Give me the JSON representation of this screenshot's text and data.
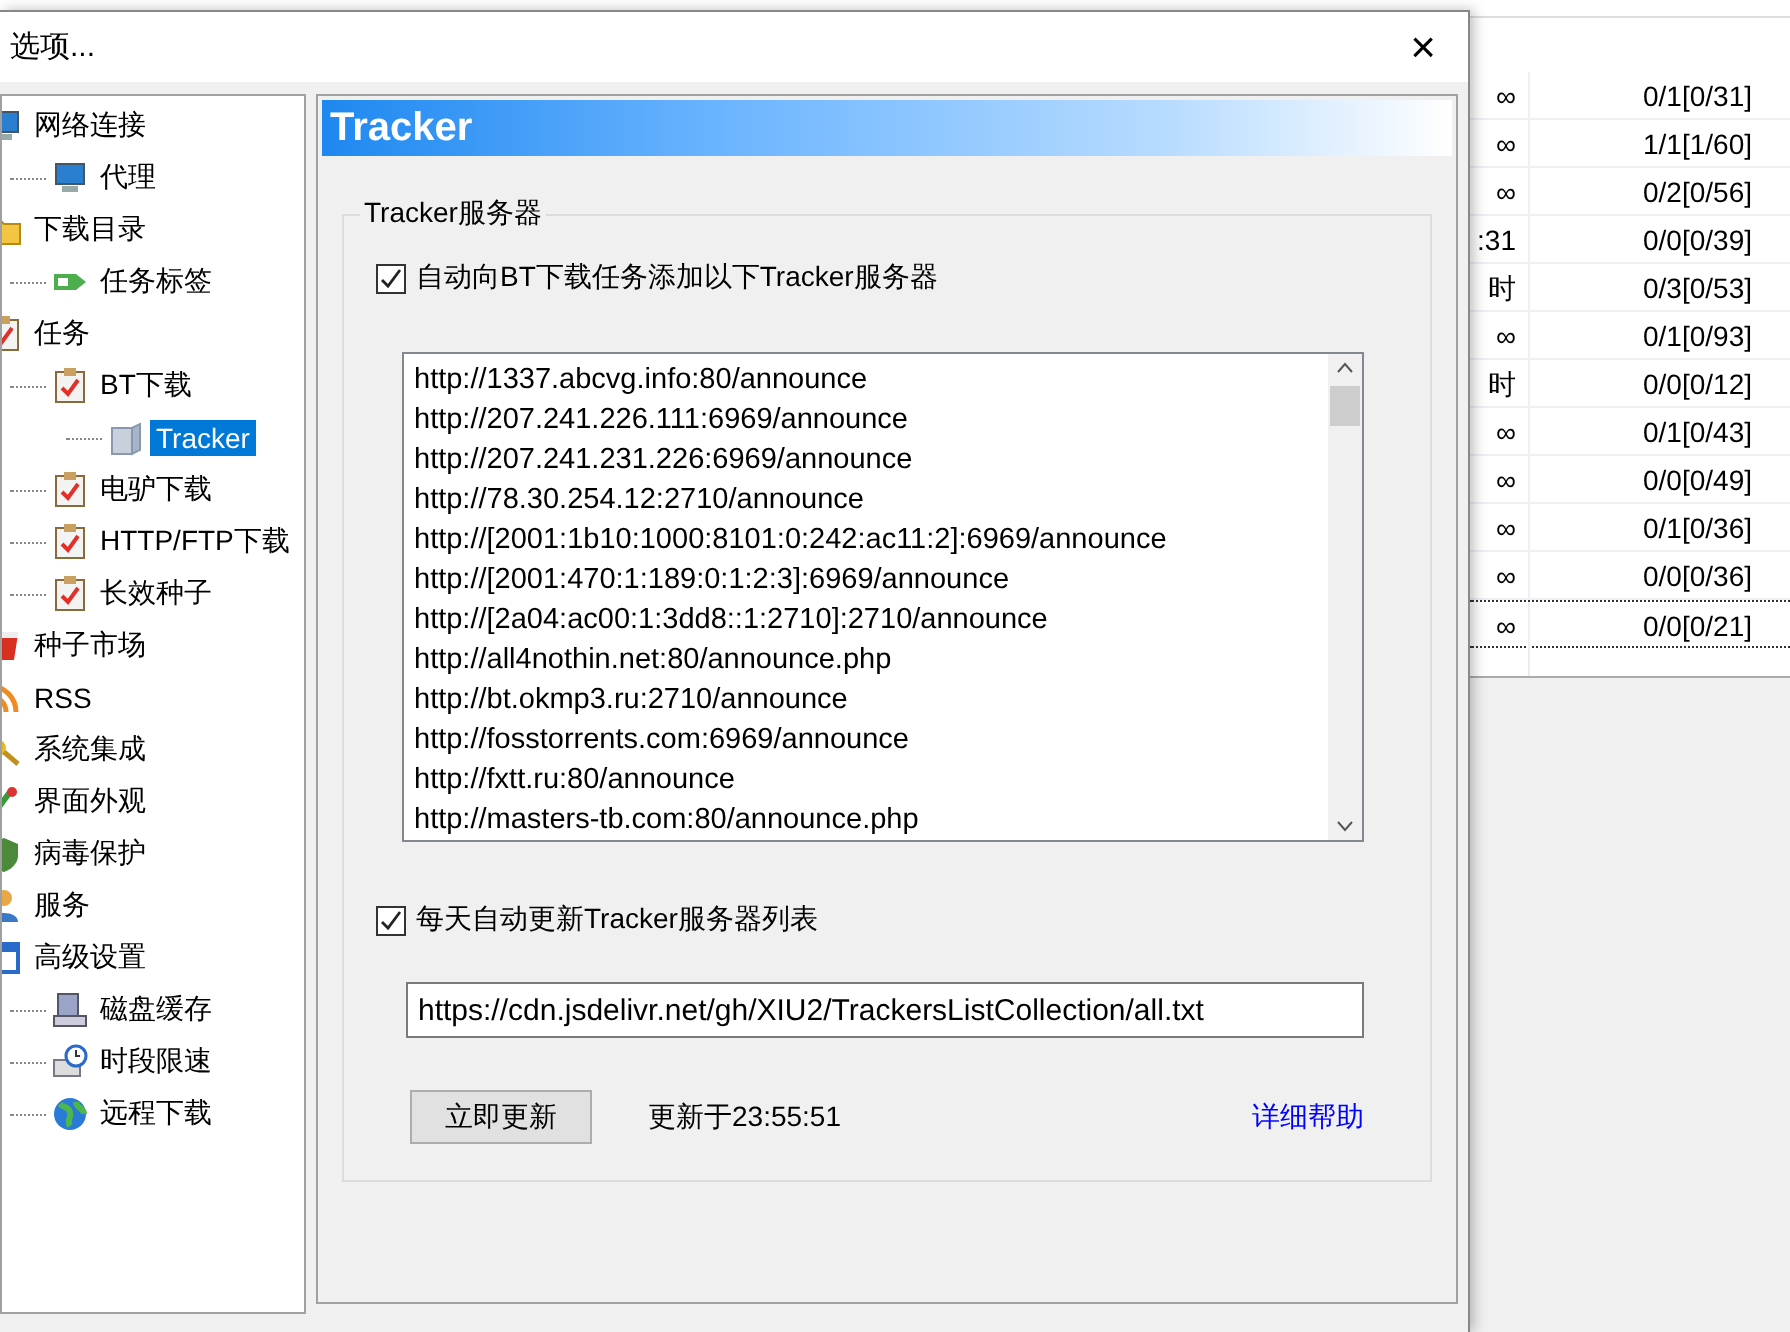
{
  "window": {
    "title": "选项...",
    "close": "×"
  },
  "tree": [
    {
      "label": "网络连接",
      "selected": false,
      "children": [
        {
          "label": "代理",
          "selected": false
        }
      ]
    },
    {
      "label": "下载目录",
      "selected": false,
      "children": [
        {
          "label": "任务标签",
          "selected": false
        }
      ]
    },
    {
      "label": "任务",
      "selected": false,
      "children": [
        {
          "label": "BT下载",
          "selected": false,
          "children": [
            {
              "label": "Tracker",
              "selected": true
            }
          ]
        },
        {
          "label": "电驴下载",
          "selected": false
        },
        {
          "label": "HTTP/FTP下载",
          "selected": false
        },
        {
          "label": "长效种子",
          "selected": false
        }
      ]
    },
    {
      "label": "种子市场",
      "selected": false
    },
    {
      "label": "RSS",
      "selected": false
    },
    {
      "label": "系统集成",
      "selected": false
    },
    {
      "label": "界面外观",
      "selected": false
    },
    {
      "label": "病毒保护",
      "selected": false
    },
    {
      "label": "服务",
      "selected": false
    },
    {
      "label": "高级设置",
      "selected": false,
      "children": [
        {
          "label": "磁盘缓存",
          "selected": false
        },
        {
          "label": "时段限速",
          "selected": false
        },
        {
          "label": "远程下载",
          "selected": false
        }
      ]
    }
  ],
  "panel": {
    "title": "Tracker",
    "group_title": "Tracker服务器",
    "add_trackers": {
      "label": "自动向BT下载任务添加以下Tracker服务器",
      "checked": true
    },
    "tracker_list": [
      "http://1337.abcvg.info:80/announce",
      "http://207.241.226.111:6969/announce",
      "http://207.241.231.226:6969/announce",
      "http://78.30.254.12:2710/announce",
      "http://[2001:1b10:1000:8101:0:242:ac11:2]:6969/announce",
      "http://[2001:470:1:189:0:1:2:3]:6969/announce",
      "http://[2a04:ac00:1:3dd8::1:2710]:2710/announce",
      "http://all4nothin.net:80/announce.php",
      "http://bt.okmp3.ru:2710/announce",
      "http://fosstorrents.com:6969/announce",
      "http://fxtt.ru:80/announce",
      "http://masters-tb.com:80/announce.php"
    ],
    "auto_update": {
      "label": "每天自动更新Tracker服务器列表",
      "checked": true
    },
    "update_url": "https://cdn.jsdelivr.net/gh/XIU2/TrackersListCollection/all.txt",
    "update_button": "立即更新",
    "last_update": "更新于23:55:51",
    "help_link": "详细帮助"
  },
  "background_table": {
    "rows": [
      {
        "column_1": "∞",
        "column_2": "0/1[0/31]"
      },
      {
        "column_1": "∞",
        "column_2": "1/1[1/60]"
      },
      {
        "column_1": "∞",
        "column_2": "0/2[0/56]"
      },
      {
        "column_1": ":31",
        "column_2": "0/0[0/39]"
      },
      {
        "column_1": "时",
        "column_2": "0/3[0/53]"
      },
      {
        "column_1": "∞",
        "column_2": "0/1[0/93]"
      },
      {
        "column_1": "时",
        "column_2": "0/0[0/12]"
      },
      {
        "column_1": "∞",
        "column_2": "0/1[0/43]"
      },
      {
        "column_1": "∞",
        "column_2": "0/0[0/49]"
      },
      {
        "column_1": "∞",
        "column_2": "0/1[0/36]"
      },
      {
        "column_1": "∞",
        "column_2": "0/0[0/36]"
      },
      {
        "column_1": "∞",
        "column_2": "0/0[0/21]"
      }
    ]
  }
}
